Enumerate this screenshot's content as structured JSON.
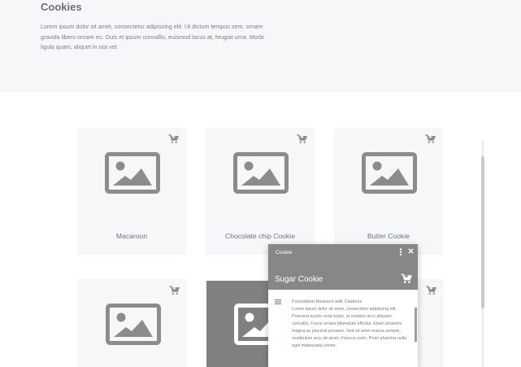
{
  "header": {
    "title": "Cookies",
    "description": "Lorem ipsum dolor sit amet, consectetur adipiscing elit. Ut dictum tempus sem, ornare gravida libero ornare eu. Duis et ipsum convallis, euismod lacus at, feugiat urna. Morbi ligula quam, aliquet in nisi vel."
  },
  "products": [
    {
      "name": "Macaroon",
      "icon": "image-placeholder-icon"
    },
    {
      "name": "Chocolate chip Cookie",
      "icon": "image-placeholder-icon"
    },
    {
      "name": "Butter Cookie",
      "icon": "image-placeholder-icon"
    }
  ],
  "popup": {
    "caption": "Cookie",
    "title": "Sugar Cookie",
    "subtitle": "Foundation Reseach with Citations",
    "text": "Lorem ipsum dolor sit amet, consectetur adipiscing elit. Praesent auctor urna turpis, at sodales arcu aliquam convallis. Fusce ornare bibendum efficitur. Etiam pharetra magna ac placerat posuere. Sed sit amet massa semper, vestibulum arcu sit amet, rhoncus enim. Proin pharetra nulla eget malesuada venen."
  },
  "colors": {
    "header_bg": "#f6f7f9",
    "card_bg": "#f6f7f9",
    "icon_gray": "#8c8c8c",
    "popup_header": "#878787"
  }
}
